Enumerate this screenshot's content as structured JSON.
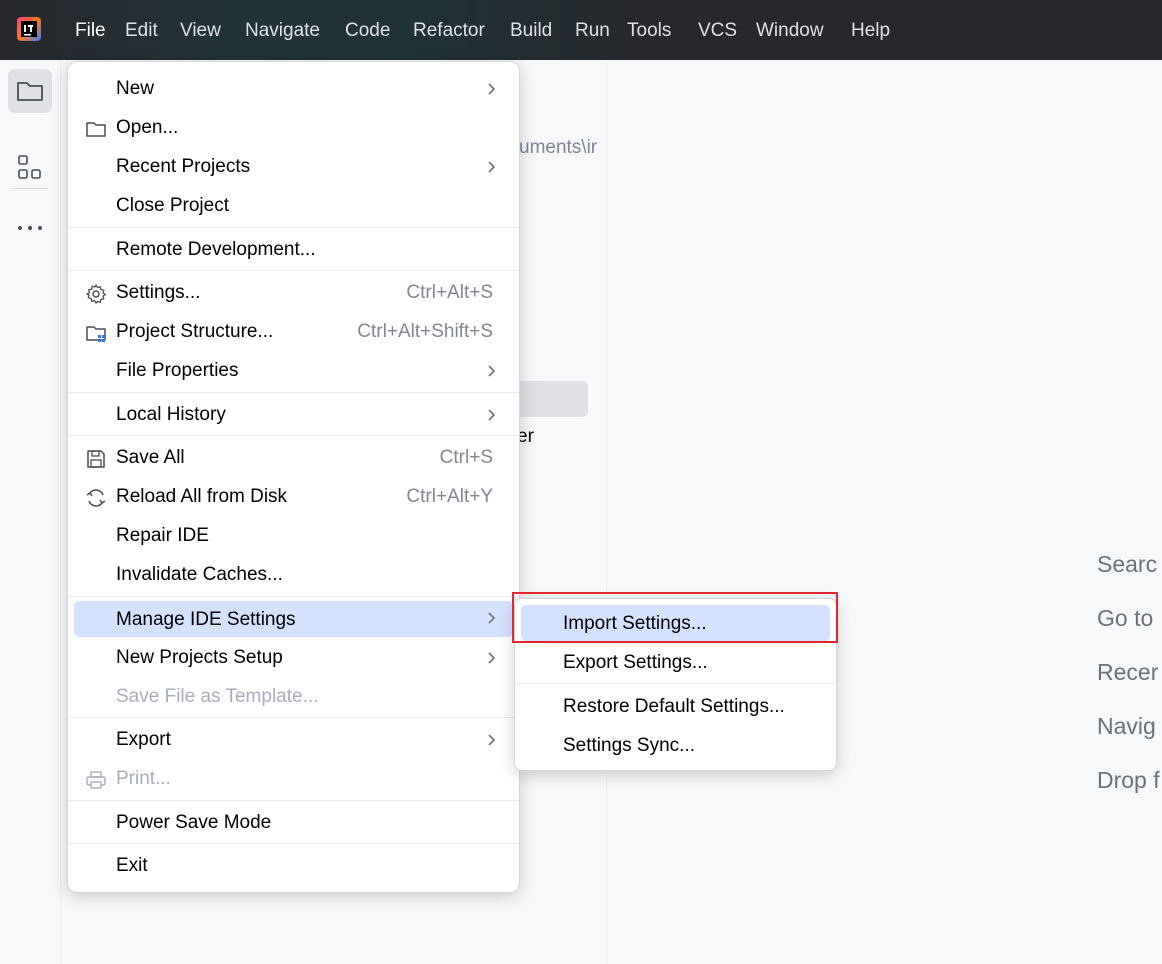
{
  "menubar": {
    "items": [
      "File",
      "Edit",
      "View",
      "Navigate",
      "Code",
      "Refactor",
      "Build",
      "Run",
      "Tools",
      "VCS",
      "Window",
      "Help"
    ]
  },
  "background": {
    "path_fragment": "uments\\ir",
    "item_fragment": "er",
    "hints": [
      "Searc",
      "Go to",
      "Recer",
      "Navig",
      "Drop f"
    ]
  },
  "file_menu": {
    "new": "New",
    "open": "Open...",
    "recent_projects": "Recent Projects",
    "close_project": "Close Project",
    "remote_development": "Remote Development...",
    "settings": "Settings...",
    "settings_shortcut": "Ctrl+Alt+S",
    "project_structure": "Project Structure...",
    "project_structure_shortcut": "Ctrl+Alt+Shift+S",
    "file_properties": "File Properties",
    "local_history": "Local History",
    "save_all": "Save All",
    "save_all_shortcut": "Ctrl+S",
    "reload_all": "Reload All from Disk",
    "reload_all_shortcut": "Ctrl+Alt+Y",
    "repair_ide": "Repair IDE",
    "invalidate_caches": "Invalidate Caches...",
    "manage_ide_settings": "Manage IDE Settings",
    "new_projects_setup": "New Projects Setup",
    "save_as_template": "Save File as Template...",
    "export": "Export",
    "print": "Print...",
    "power_save_mode": "Power Save Mode",
    "exit": "Exit"
  },
  "submenu": {
    "import_settings": "Import Settings...",
    "export_settings": "Export Settings...",
    "restore_default": "Restore Default Settings...",
    "settings_sync": "Settings Sync..."
  },
  "colors": {
    "highlight": "#d4e2ff",
    "annotation_red": "#e0282e",
    "topbar": "#27282c"
  }
}
